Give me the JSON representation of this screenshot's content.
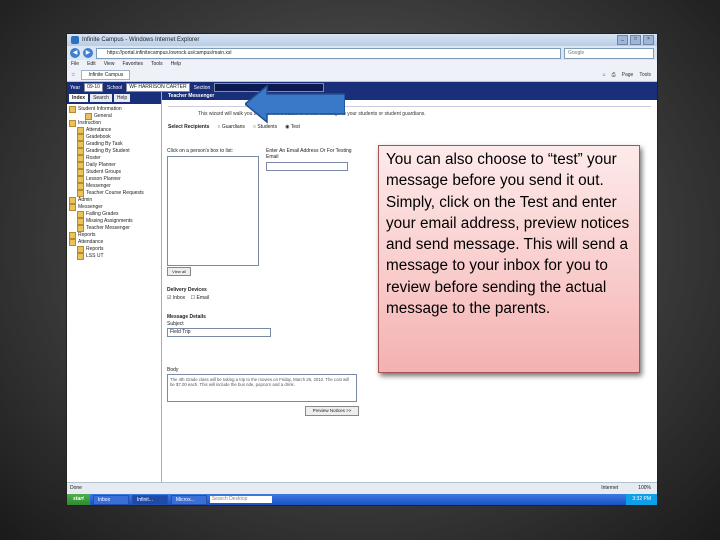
{
  "browser": {
    "title": "Infinite Campus - Windows Internet Explorer",
    "address": "https://portal.infinitecampus.lowrock.us/campus/main.xsl",
    "search_placeholder": "Google",
    "menu": [
      "File",
      "Edit",
      "View",
      "Favorites",
      "Tools",
      "Help"
    ],
    "tab": "Infinite Campus",
    "tools": [
      "Page",
      "Tools"
    ]
  },
  "campus_bar": {
    "year_label": "Year",
    "year_value": "09-10",
    "school_label": "School",
    "school_value": "WF HARRISON CARTER",
    "section_label": "Section"
  },
  "nav": {
    "tabs": [
      "Index",
      "Search",
      "Help"
    ],
    "tree": [
      "Student Information",
      "General",
      "Instruction",
      "Attendance",
      "Gradebook",
      "Grading By Task",
      "Grading By Student",
      "Roster",
      "Daily Planner",
      "Student Groups",
      "Lesson Planner",
      "Messenger",
      "Teacher Course Requests",
      "Admin",
      "Messenger",
      "Failing Grades",
      "Missing Assignments",
      "Teacher Messenger",
      "Reports",
      "Attendance",
      "Reports",
      "LSS UT"
    ]
  },
  "main": {
    "header": "Teacher Messenger",
    "note": "This wizard will walk you through the creation of a new message to your students or student guardians.",
    "select_recipients_label": "Select Recipients",
    "recipient_options": [
      "Guardians",
      "Students",
      "Test"
    ],
    "click_label": "Click on a person's box to list:",
    "email_label": "Enter An Email Address Or For Testing",
    "email_sub": "Email",
    "view_all": "View all",
    "delivery_label": "Delivery Devices",
    "delivery_options": [
      "Inbox",
      "Email"
    ],
    "message_details_label": "Message Details",
    "subject_label": "Subject",
    "subject_value": "Field Trip",
    "body_label": "Body",
    "body_value": "The 4th Grade class will be taking a trip to the movies on Friday, March 26, 2010. The cost will be $7.00 each. This will include the bus ride, popcorn and a drink.",
    "preview_button": "Preview Notices >>"
  },
  "status_bar": {
    "left": "Done",
    "zone": "Internet",
    "zoom": "100%"
  },
  "taskbar": {
    "start": "start",
    "tasks": [
      "Inbox",
      "Infinit...",
      "Micros..."
    ],
    "search": "Search Desktop",
    "clock": "3:32 PM"
  },
  "callout": {
    "text": "You can also choose to “test” your message before you send it out.  Simply, click on the Test and enter your email address, preview notices and send message.  This will send a message to your inbox for you to review before sending the actual message to the parents."
  },
  "colors": {
    "campus_navy": "#1a2f79",
    "callout_fill": "#f9caca",
    "arrow_fill": "#3a78c8"
  }
}
